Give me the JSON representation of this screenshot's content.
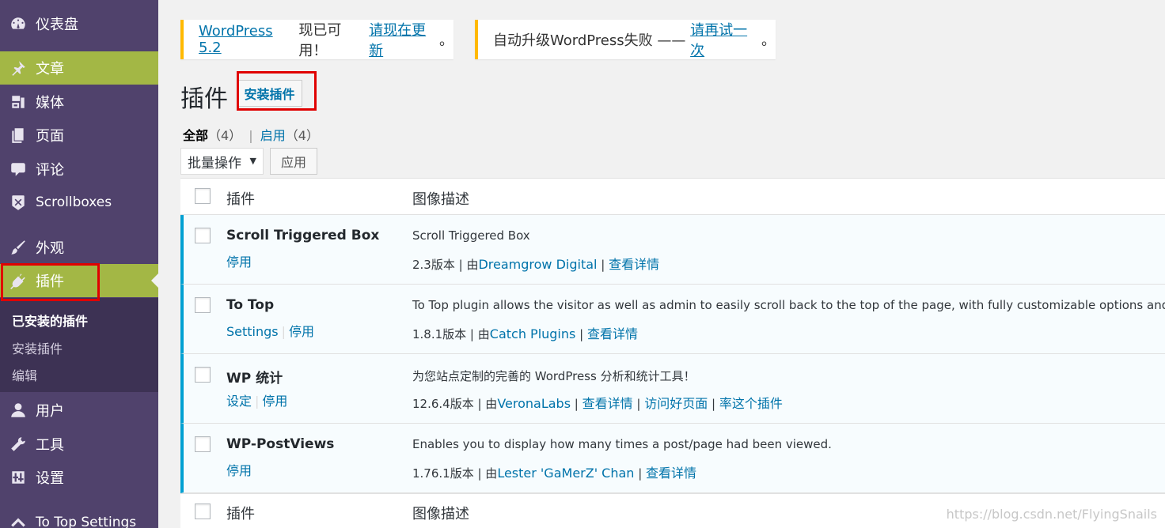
{
  "sidebar": {
    "items": [
      {
        "label": "仪表盘",
        "icon": "dashboard-icon"
      },
      {
        "label": "文章",
        "icon": "pin-icon"
      },
      {
        "label": "媒体",
        "icon": "media-icon"
      },
      {
        "label": "页面",
        "icon": "page-icon"
      },
      {
        "label": "评论",
        "icon": "comment-icon"
      },
      {
        "label": "Scrollboxes",
        "icon": "scrollbox-icon"
      },
      {
        "label": "外观",
        "icon": "brush-icon"
      },
      {
        "label": "插件",
        "icon": "plugin-icon"
      },
      {
        "label": "用户",
        "icon": "user-icon"
      },
      {
        "label": "工具",
        "icon": "wrench-icon"
      },
      {
        "label": "设置",
        "icon": "settings-icon"
      },
      {
        "label": "To Top Settings",
        "icon": "arrow-up-icon"
      }
    ],
    "submenu": [
      "已安装的插件",
      "安装插件",
      "编辑"
    ]
  },
  "notices": {
    "update": {
      "link1": "WordPress 5.2",
      "text": "现已可用！",
      "link2": "请现在更新",
      "end": "。"
    },
    "failed": {
      "text": "自动升级WordPress失败 —— ",
      "link": "请再试一次",
      "end": "。"
    }
  },
  "header": {
    "title": "插件",
    "add_button": "安装插件"
  },
  "filters": {
    "all_label": "全部",
    "all_count": "（4）",
    "separator": "|",
    "active_label": "启用",
    "active_count": "（4）"
  },
  "bulk": {
    "selected": "批量操作",
    "caret": "▼",
    "apply": "应用"
  },
  "table": {
    "col_plugin": "插件",
    "col_desc": "图像描述",
    "rows": [
      {
        "name": "Scroll Triggered Box",
        "actions": [
          "停用"
        ],
        "desc": "Scroll Triggered Box",
        "version": "2.3版本 | 由",
        "author": "Dreamgrow Digital",
        "links": [
          "查看详情"
        ]
      },
      {
        "name": "To Top",
        "actions": [
          "Settings",
          "停用"
        ],
        "desc": "To Top plugin allows the visitor as well as admin to easily scroll back to the top of the page, with fully customizable options and abilit",
        "version": "1.8.1版本 | 由",
        "author": "Catch Plugins",
        "links": [
          "查看详情"
        ]
      },
      {
        "name": "WP 统计",
        "actions": [
          "设定",
          "停用"
        ],
        "desc": "为您站点定制的完善的 WordPress 分析和统计工具！",
        "version": "12.6.4版本 | 由",
        "author": "VeronaLabs",
        "links": [
          "查看详情",
          "访问好页面",
          "率这个插件"
        ]
      },
      {
        "name": "WP-PostViews",
        "actions": [
          "停用"
        ],
        "desc": "Enables you to display how many times a post/page had been viewed.",
        "version": "1.76.1版本 | 由",
        "author": "Lester 'GaMerZ' Chan",
        "links": [
          "查看详情"
        ]
      }
    ]
  },
  "watermark": "https://blog.csdn.net/FlyingSnails",
  "colors": {
    "sidebar": "#50426c",
    "accent": "#a3b745",
    "link": "#0073aa",
    "active_border": "#00a0d2",
    "notice_border": "#ffb900",
    "highlight": "#e00000"
  }
}
